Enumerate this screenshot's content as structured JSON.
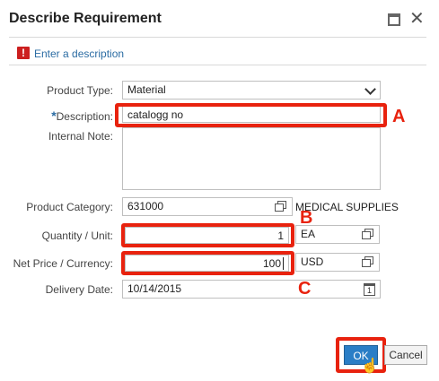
{
  "dialog": {
    "title": "Describe Requirement"
  },
  "message": {
    "icon_text": "!",
    "text": "Enter a description"
  },
  "form": {
    "product_type": {
      "label": "Product Type:",
      "value": "Material"
    },
    "description": {
      "required_mark": "*",
      "label": "Description:",
      "value": "catalogg no"
    },
    "internal_note": {
      "label": "Internal Note:",
      "value": ""
    },
    "product_category": {
      "label": "Product Category:",
      "value": "631000",
      "text": "MEDICAL SUPPLIES"
    },
    "quantity_unit": {
      "label": "Quantity / Unit:",
      "quantity": "1",
      "unit": "EA"
    },
    "net_price_currency": {
      "label": "Net Price / Currency:",
      "price": "100",
      "currency": "USD"
    },
    "delivery_date": {
      "label": "Delivery Date:",
      "value": "10/14/2015",
      "icon_text": "1"
    }
  },
  "annotations": {
    "a": "A",
    "b": "B",
    "c": "C"
  },
  "buttons": {
    "ok": "OK",
    "cancel": "Cancel"
  },
  "colors": {
    "highlight": "#e8220e",
    "primary": "#2a7ec6",
    "link": "#2b6ca3"
  }
}
